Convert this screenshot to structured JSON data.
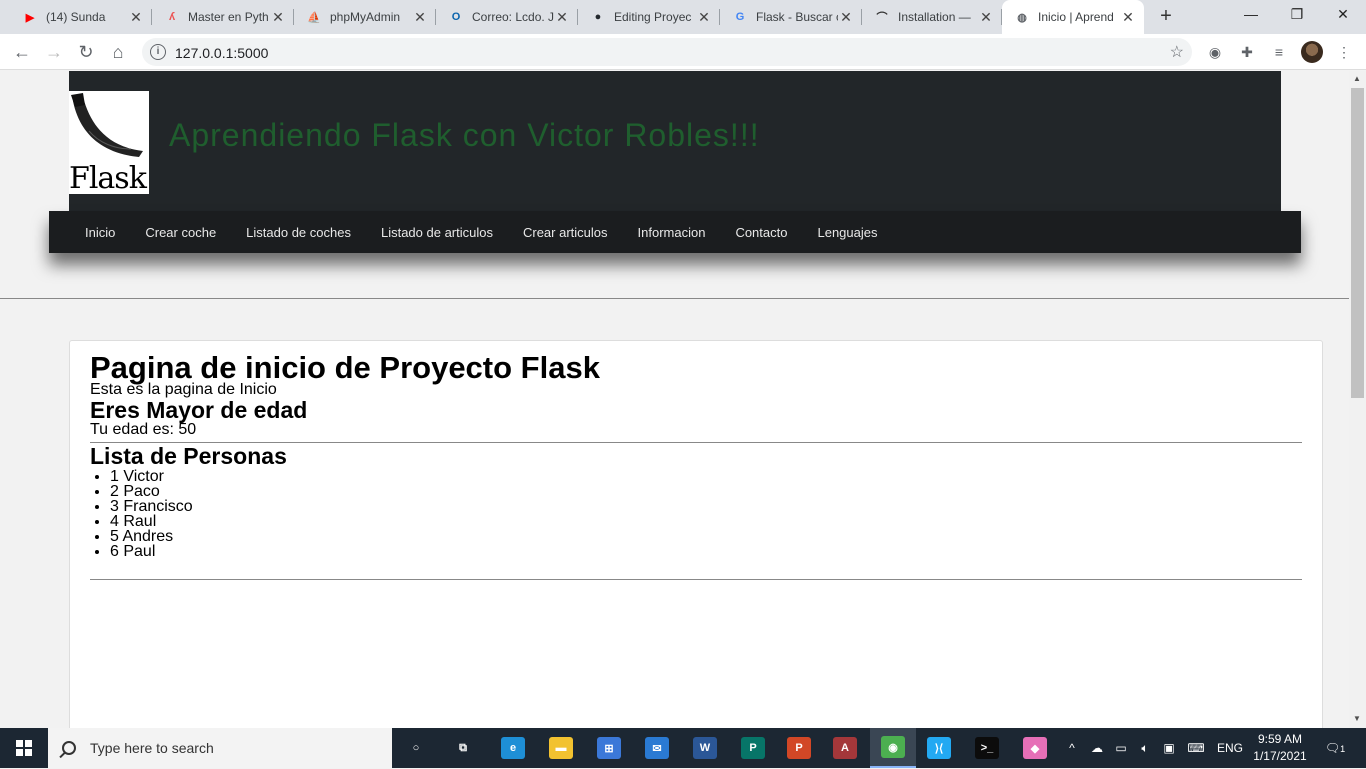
{
  "browser": {
    "tabs": [
      {
        "title": "(14) Sunda",
        "icon": "youtube-icon",
        "fav_color": "#ff0000",
        "fav_text": "▶"
      },
      {
        "title": "Master en Pyth",
        "icon": "udemy-icon",
        "fav_color": "#ec5252",
        "fav_text": "ʎ"
      },
      {
        "title": "phpMyAdmin",
        "icon": "phpmyadmin-icon",
        "fav_color": "#f89c0e",
        "fav_text": "⛵"
      },
      {
        "title": "Correo: Lcdo. J",
        "icon": "outlook-icon",
        "fav_color": "#0a64ad",
        "fav_text": "O"
      },
      {
        "title": "Editing Proyec",
        "icon": "github-icon",
        "fav_color": "#24292e",
        "fav_text": "●"
      },
      {
        "title": "Flask - Buscar c",
        "icon": "google-icon",
        "fav_color": "#4285f4",
        "fav_text": "G"
      },
      {
        "title": "Installation —",
        "icon": "flask-docs-icon",
        "fav_color": "#333333",
        "fav_text": "⌒"
      },
      {
        "title": "Inicio | Aprend",
        "icon": "globe-icon",
        "fav_color": "#5f6368",
        "fav_text": "◍"
      }
    ],
    "url": "127.0.0.1:5000"
  },
  "site": {
    "logo_text": "Flask",
    "title": "Aprendiendo Flask con Victor Robles!!!",
    "menu": [
      "Inicio",
      "Crear coche",
      "Listado de coches",
      "Listado de articulos",
      "Crear articulos",
      "Informacion",
      "Contacto",
      "Lenguajes"
    ]
  },
  "main": {
    "heading": "Pagina de inicio de Proyecto Flask",
    "subtitle": "Esta es la pagina de Inicio",
    "age_heading": "Eres Mayor de edad",
    "age_text": "Tu edad es: 50",
    "list_heading": "Lista de Personas",
    "people": [
      "1 Victor",
      "2 Paco",
      "3 Francisco",
      "4 Raul",
      "5 Andres",
      "6 Paul"
    ]
  },
  "taskbar": {
    "search_placeholder": "Type here to search",
    "apps": [
      {
        "name": "cortana-icon",
        "color": "transparent",
        "text": "○"
      },
      {
        "name": "task-view-icon",
        "color": "transparent",
        "text": "⧉"
      },
      {
        "name": "edge-icon",
        "color": "#1e8fd6",
        "text": "e"
      },
      {
        "name": "file-explorer-icon",
        "color": "#f2c230",
        "text": "▬"
      },
      {
        "name": "store-icon",
        "color": "#3b78d8",
        "text": "⊞"
      },
      {
        "name": "mail-icon",
        "color": "#2a7ad3",
        "text": "✉"
      },
      {
        "name": "word-icon",
        "color": "#2b5797",
        "text": "W"
      },
      {
        "name": "publisher-icon",
        "color": "#077568",
        "text": "P"
      },
      {
        "name": "powerpoint-icon",
        "color": "#d24726",
        "text": "P"
      },
      {
        "name": "access-icon",
        "color": "#a4373a",
        "text": "A"
      },
      {
        "name": "chrome-icon",
        "color": "#4caf50",
        "text": "◉"
      },
      {
        "name": "vscode-icon",
        "color": "#23a9f2",
        "text": "⟩⟨"
      },
      {
        "name": "terminal-icon",
        "color": "#0c0c0c",
        "text": ">_"
      },
      {
        "name": "paint-icon",
        "color": "#e66fb7",
        "text": "◆"
      }
    ],
    "language": "ENG",
    "time": "9:59 AM",
    "date": "1/17/2021",
    "notification_count": "1"
  }
}
